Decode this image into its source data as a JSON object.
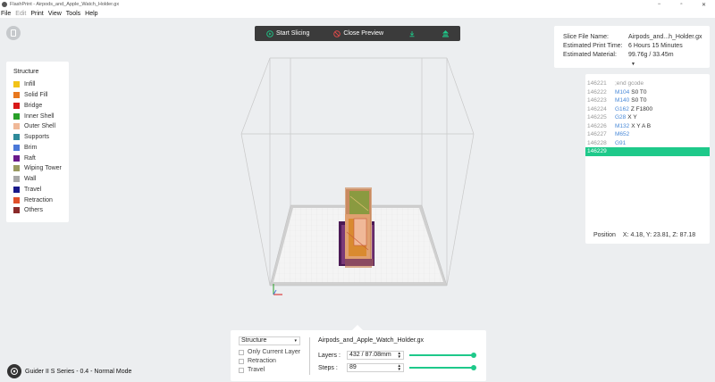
{
  "window": {
    "title": "FlashPrint - Airpods_and_Apple_Watch_Holder.gx",
    "minimize": "−",
    "maximize": "▫",
    "close": "✕"
  },
  "menu": [
    {
      "label": "File",
      "enabled": true
    },
    {
      "label": "Edit",
      "enabled": false
    },
    {
      "label": "Print",
      "enabled": true
    },
    {
      "label": "View",
      "enabled": true
    },
    {
      "label": "Tools",
      "enabled": true
    },
    {
      "label": "Help",
      "enabled": true
    }
  ],
  "toolbar": {
    "start_slicing": "Start Slicing",
    "close_preview": "Close Preview",
    "accent_start": "#1ec98a",
    "accent_close": "#e94b4b"
  },
  "legend": {
    "title": "Structure",
    "items": [
      {
        "label": "Infill",
        "color": "#f2c318"
      },
      {
        "label": "Solid Fill",
        "color": "#e8781e"
      },
      {
        "label": "Bridge",
        "color": "#d81818"
      },
      {
        "label": "Inner Shell",
        "color": "#28a028"
      },
      {
        "label": "Outer Shell",
        "color": "#f0b898"
      },
      {
        "label": "Supports",
        "color": "#2e8a9a"
      },
      {
        "label": "Brim",
        "color": "#4a78d8"
      },
      {
        "label": "Raft",
        "color": "#6a1a8a"
      },
      {
        "label": "Wiping Tower",
        "color": "#9a9a60"
      },
      {
        "label": "Wall",
        "color": "#a8a8a8"
      },
      {
        "label": "Travel",
        "color": "#1a1a8a"
      },
      {
        "label": "Retraction",
        "color": "#e0502a"
      },
      {
        "label": "Others",
        "color": "#8a2a2a"
      }
    ]
  },
  "info": {
    "file_name_label": "Slice File Name:",
    "file_name": "Airpods_and...h_Holder.gx",
    "time_label": "Estimated Print Time:",
    "time": "6 Hours 15 Minutes",
    "material_label": "Estimated Material:",
    "material": "99.76g / 33.45m",
    "caret": "▼"
  },
  "gcode": {
    "lines": [
      {
        "num": "146221",
        "cmd": "",
        "args": ";end gcode",
        "active": false
      },
      {
        "num": "146222",
        "cmd": "M104",
        "args": "S0 T0",
        "active": false
      },
      {
        "num": "146223",
        "cmd": "M140",
        "args": "S0 T0",
        "active": false
      },
      {
        "num": "146224",
        "cmd": "G162",
        "args": "Z F1800",
        "active": false
      },
      {
        "num": "146225",
        "cmd": "G28",
        "args": "X Y",
        "active": false
      },
      {
        "num": "146226",
        "cmd": "M132",
        "args": "X Y A B",
        "active": false
      },
      {
        "num": "146227",
        "cmd": "M652",
        "args": "",
        "active": false
      },
      {
        "num": "146228",
        "cmd": "G91",
        "args": "",
        "active": false
      },
      {
        "num": "146229",
        "cmd": "",
        "args": "",
        "active": true
      }
    ],
    "position_label": "Position",
    "position_value": "X: 4.18, Y: 23.81, Z: 87.18"
  },
  "bottom": {
    "mode": "Structure",
    "mode_caret": "▾",
    "only_current_layer": "Only Current Layer",
    "retraction": "Retraction",
    "travel": "Travel",
    "file_name": "Airpods_and_Apple_Watch_Holder.gx",
    "layers_label": "Layers :",
    "layers_value": "432 / 87.08mm",
    "layers_fraction": 1.0,
    "steps_label": "Steps :",
    "steps_value": "89",
    "steps_fraction": 1.0,
    "spin_arrows_up": "▲",
    "spin_arrows_down": "▼"
  },
  "status": {
    "machine": "Guider II S Series - 0.4 - Normal Mode"
  }
}
